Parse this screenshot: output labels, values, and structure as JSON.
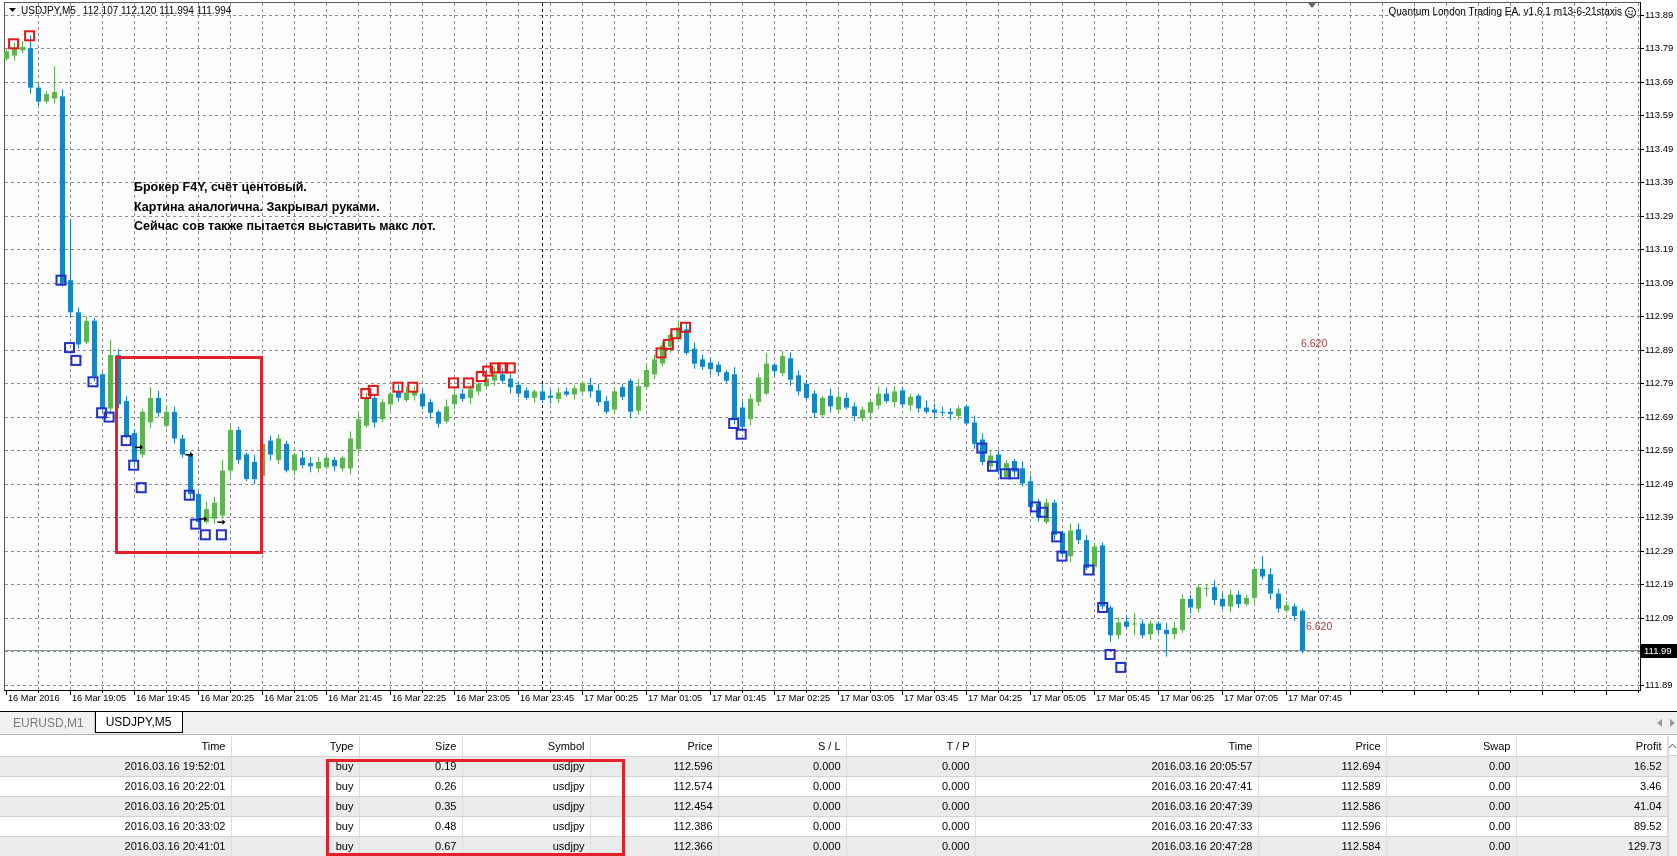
{
  "chart": {
    "symbol": "USDJPY,M5",
    "quote": "112.107 112.120 111.994 111.994",
    "expert_label": "Quantum London Trading EA. v1.6.1 m13-6-21staxis",
    "annotation_lines": [
      "Брокер F4Y, счёт центовый.",
      "Картина аналогична. Закрывал руками.",
      "Сейчас сов также пытается выставить макс лот."
    ],
    "level_labels": [
      "6.620",
      "6.620"
    ],
    "price_axis": [
      {
        "kind": "tick",
        "label": "113.89"
      },
      {
        "kind": "tick",
        "label": "113.79"
      },
      {
        "kind": "tick",
        "label": "113.69"
      },
      {
        "kind": "tick",
        "label": "113.59"
      },
      {
        "kind": "tick",
        "label": "113.49"
      },
      {
        "kind": "tick",
        "label": "113.39"
      },
      {
        "kind": "tick",
        "label": "113.29"
      },
      {
        "kind": "tick",
        "label": "113.19"
      },
      {
        "kind": "tick",
        "label": "113.09"
      },
      {
        "kind": "tick",
        "label": "112.99"
      },
      {
        "kind": "tick",
        "label": "112.89"
      },
      {
        "kind": "tick",
        "label": "112.79"
      },
      {
        "kind": "tick",
        "label": "112.69"
      },
      {
        "kind": "tick",
        "label": "112.59"
      },
      {
        "kind": "tick",
        "label": "112.49"
      },
      {
        "kind": "tick",
        "label": "112.39"
      },
      {
        "kind": "tick",
        "label": "112.29"
      },
      {
        "kind": "tick",
        "label": "112.19"
      },
      {
        "kind": "tick",
        "label": "112.09"
      },
      {
        "kind": "current",
        "label": "111.99"
      },
      {
        "kind": "tick",
        "label": "111.89"
      }
    ],
    "time_axis": [
      "16 Mar 2016",
      "16 Mar 19:05",
      "16 Mar 19:45",
      "16 Mar 20:25",
      "16 Mar 21:05",
      "16 Mar 21:45",
      "16 Mar 22:25",
      "16 Mar 23:05",
      "16 Mar 23:45",
      "17 Mar 00:25",
      "17 Mar 01:05",
      "17 Mar 01:45",
      "17 Mar 02:25",
      "17 Mar 03:05",
      "17 Mar 03:45",
      "17 Mar 04:25",
      "17 Mar 05:05",
      "17 Mar 05:45",
      "17 Mar 06:25",
      "17 Mar 07:05",
      "17 Mar 07:45"
    ]
  },
  "chart_tabs": [
    {
      "label": "EURUSD,M1",
      "selected": false
    },
    {
      "label": "USDJPY,M5",
      "selected": true
    }
  ],
  "trade_table": {
    "columns": [
      "Time",
      "Type",
      "Size",
      "Symbol",
      "Price",
      "S / L",
      "T / P",
      "Time",
      "Price",
      "Swap",
      "Profit"
    ],
    "rows": [
      [
        "2016.03.16 19:52:01",
        "buy",
        "0.19",
        "usdjpy",
        "112.596",
        "0.000",
        "0.000",
        "2016.03.16 20:05:57",
        "112.694",
        "0.00",
        "16.52"
      ],
      [
        "2016.03.16 20:22:01",
        "buy",
        "0.26",
        "usdjpy",
        "112.574",
        "0.000",
        "0.000",
        "2016.03.16 20:47:41",
        "112.589",
        "0.00",
        "3.46"
      ],
      [
        "2016.03.16 20:25:01",
        "buy",
        "0.35",
        "usdjpy",
        "112.454",
        "0.000",
        "0.000",
        "2016.03.16 20:47:39",
        "112.586",
        "0.00",
        "41.04"
      ],
      [
        "2016.03.16 20:33:02",
        "buy",
        "0.48",
        "usdjpy",
        "112.386",
        "0.000",
        "0.000",
        "2016.03.16 20:47:33",
        "112.596",
        "0.00",
        "89.52"
      ],
      [
        "2016.03.16 20:41:01",
        "buy",
        "0.67",
        "usdjpy",
        "112.366",
        "0.000",
        "0.000",
        "2016.03.16 20:47:28",
        "112.584",
        "0.00",
        "129.73"
      ]
    ]
  }
}
